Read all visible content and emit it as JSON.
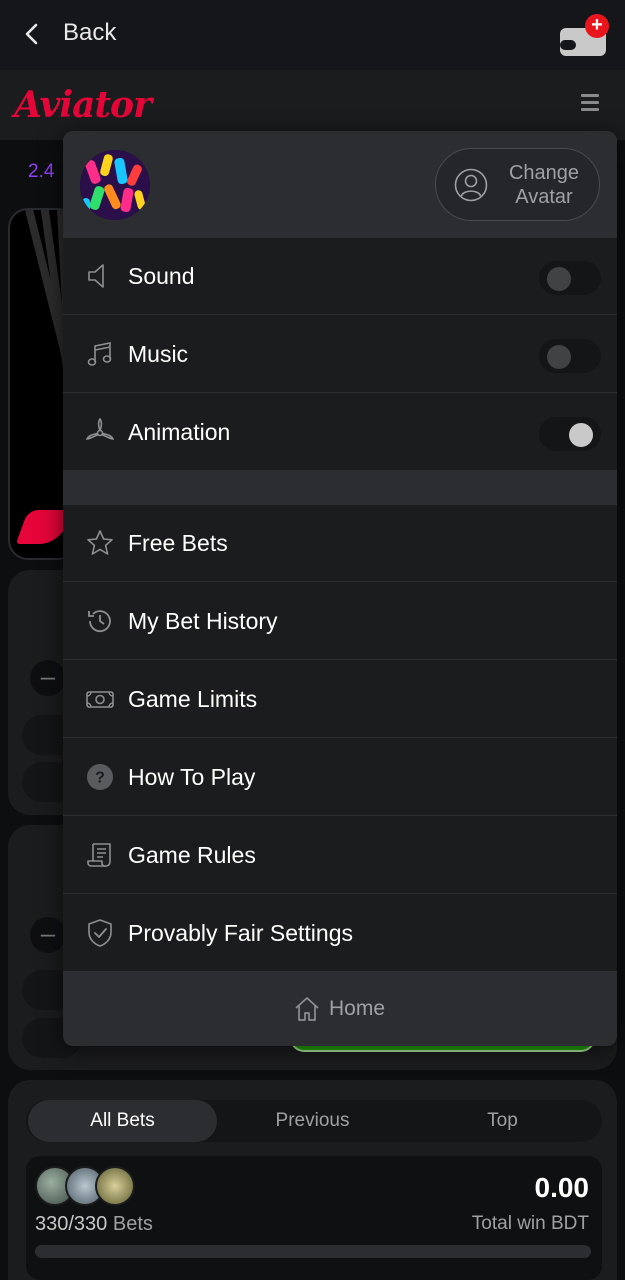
{
  "topbar": {
    "back_label": "Back"
  },
  "game": {
    "logo": "Aviator",
    "multiplier_peek": "2.4",
    "brand_color": "#e50539"
  },
  "menu": {
    "change_avatar_line1": "Change",
    "change_avatar_line2": "Avatar",
    "settings": [
      {
        "label": "Sound",
        "icon": "speaker-icon",
        "enabled": false
      },
      {
        "label": "Music",
        "icon": "music-note-icon",
        "enabled": false
      },
      {
        "label": "Animation",
        "icon": "propeller-icon",
        "enabled": true
      }
    ],
    "items": [
      {
        "label": "Free Bets",
        "icon": "star-icon"
      },
      {
        "label": "My Bet History",
        "icon": "history-icon"
      },
      {
        "label": "Game Limits",
        "icon": "banknote-icon"
      },
      {
        "label": "How To Play",
        "icon": "question-icon"
      },
      {
        "label": "Game Rules",
        "icon": "scroll-icon"
      },
      {
        "label": "Provably Fair Settings",
        "icon": "shield-check-icon"
      }
    ],
    "home_label": "Home"
  },
  "bets": {
    "tabs": [
      "All Bets",
      "Previous",
      "Top"
    ],
    "active_tab": "All Bets",
    "count": "330/330",
    "count_label": "Bets",
    "total_win": "0.00",
    "total_win_label": "Total win BDT"
  }
}
